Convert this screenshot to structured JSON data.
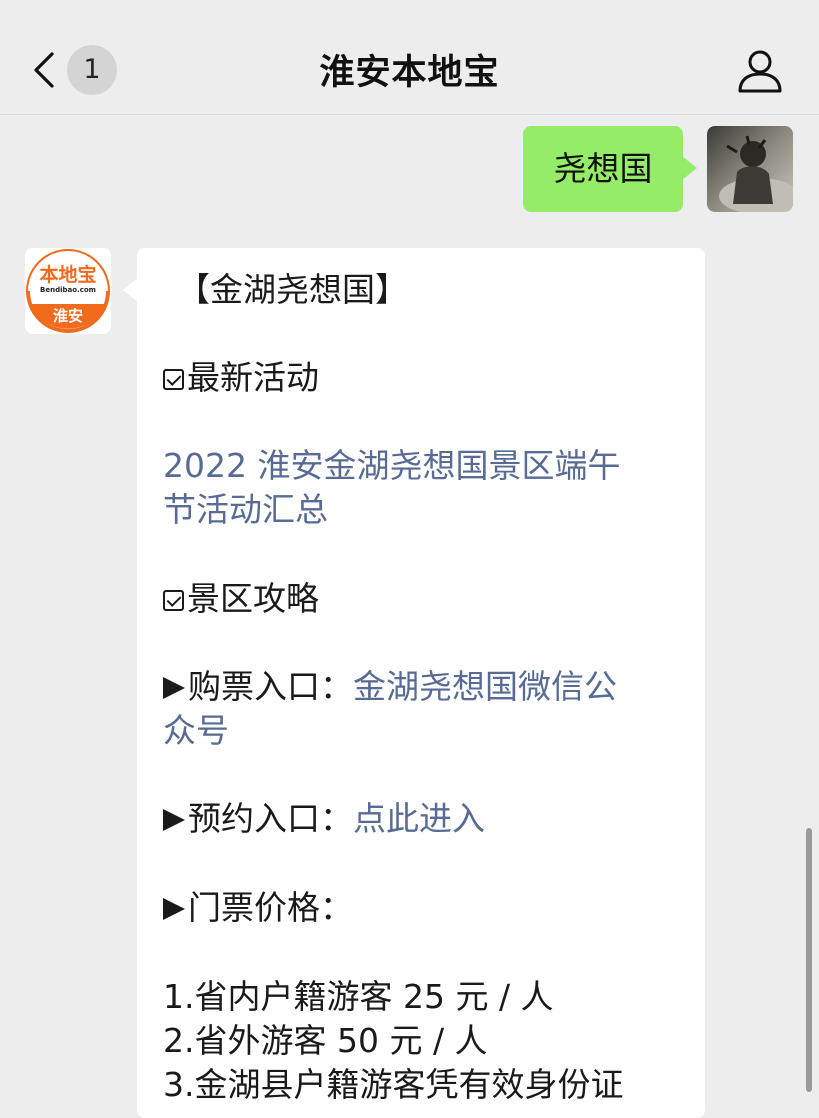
{
  "header": {
    "unread_count": "1",
    "title": "淮安本地宝"
  },
  "sent_message": {
    "text": "尧想国"
  },
  "bot": {
    "logo_top": "本地宝",
    "logo_url": "Bendibao.com",
    "logo_city": "淮安"
  },
  "reply": {
    "heading": "【金湖尧想国】",
    "section1": "最新活动",
    "link1_line1": "2022 淮安金湖尧想国景区端午",
    "link1_line2": "节活动汇总",
    "section2": "景区攻略",
    "ticket_label": "购票入口：",
    "ticket_link_line1": "金湖尧想国微信公",
    "ticket_link_line2": "众号",
    "booking_label": "预约入口：",
    "booking_link": "点此进入",
    "price_label": "门票价格：",
    "price_1": "1.省内户籍游客 25 元 / 人",
    "price_2": "2.省外游客 50 元 / 人",
    "price_3": "3.金湖县户籍游客凭有效身份证"
  },
  "colors": {
    "sent_bubble": "#95ec69",
    "link": "#576b95",
    "brand_orange": "#f26a1b"
  }
}
